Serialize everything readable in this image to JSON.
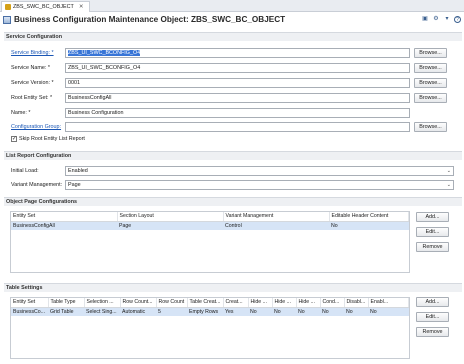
{
  "tab": {
    "label": "ZBS_SWC_BC_OBJECT",
    "close": "✕"
  },
  "header": {
    "title": "Business Configuration Maintenance Object: ZBS_SWC_BC_OBJECT"
  },
  "toolbar": {
    "icons": [
      "save-icon",
      "settings-icon",
      "menu-icon",
      "help-icon"
    ]
  },
  "service_config": {
    "heading": "Service Configuration",
    "browse_label": "Browse...",
    "service_binding": {
      "label": "Service Binding: *",
      "value": "ZBS_UI_SWC_BCONFIG_O4"
    },
    "service_name": {
      "label": "Service Name: *",
      "value": "ZBS_UI_SWC_BCONFIG_O4"
    },
    "service_version": {
      "label": "Service Version: *",
      "value": "0001"
    },
    "root_entity_set": {
      "label": "Root Entity Set: *",
      "value": "BusinessConfigAll"
    },
    "name": {
      "label": "Name: *",
      "value": "Business Configuration"
    },
    "configuration_group": {
      "label": "Configuration Group:",
      "value": ""
    },
    "skip_root": {
      "label": "Skip Root Entity List Report",
      "checked": "✓"
    }
  },
  "list_report": {
    "heading": "List Report Configuration",
    "initial_load": {
      "label": "Initial Load:",
      "value": "Enabled"
    },
    "variant_management": {
      "label": "Variant Management:",
      "value": "Page"
    }
  },
  "object_page": {
    "heading": "Object Page Configurations",
    "columns": [
      "Entity Set",
      "Section Layout",
      "Variant Management",
      "Editable Header Content"
    ],
    "rows": [
      [
        "BusinessConfigAll",
        "Page",
        "Control",
        "No"
      ]
    ],
    "buttons": {
      "add": "Add...",
      "edit": "Edit...",
      "remove": "Remove"
    }
  },
  "table_settings": {
    "heading": "Table Settings",
    "columns": [
      "Entity Set",
      "Table Type",
      "Selection ...",
      "Row Count...",
      "Row Count",
      "Table Creat...",
      "Creat...",
      "Hide ...",
      "Hide ...",
      "Hide ...",
      "Cond...",
      "Disabl...",
      "Enabl..."
    ],
    "rows": [
      [
        "BusinessCo...",
        "Grid Table",
        "Select Sing...",
        "Automatic",
        "5",
        "Empty Rows",
        "Yes",
        "No",
        "No",
        "No",
        "No",
        "No",
        "No"
      ]
    ],
    "buttons": {
      "add": "Add...",
      "edit": "Edit...",
      "remove": "Remove"
    }
  }
}
